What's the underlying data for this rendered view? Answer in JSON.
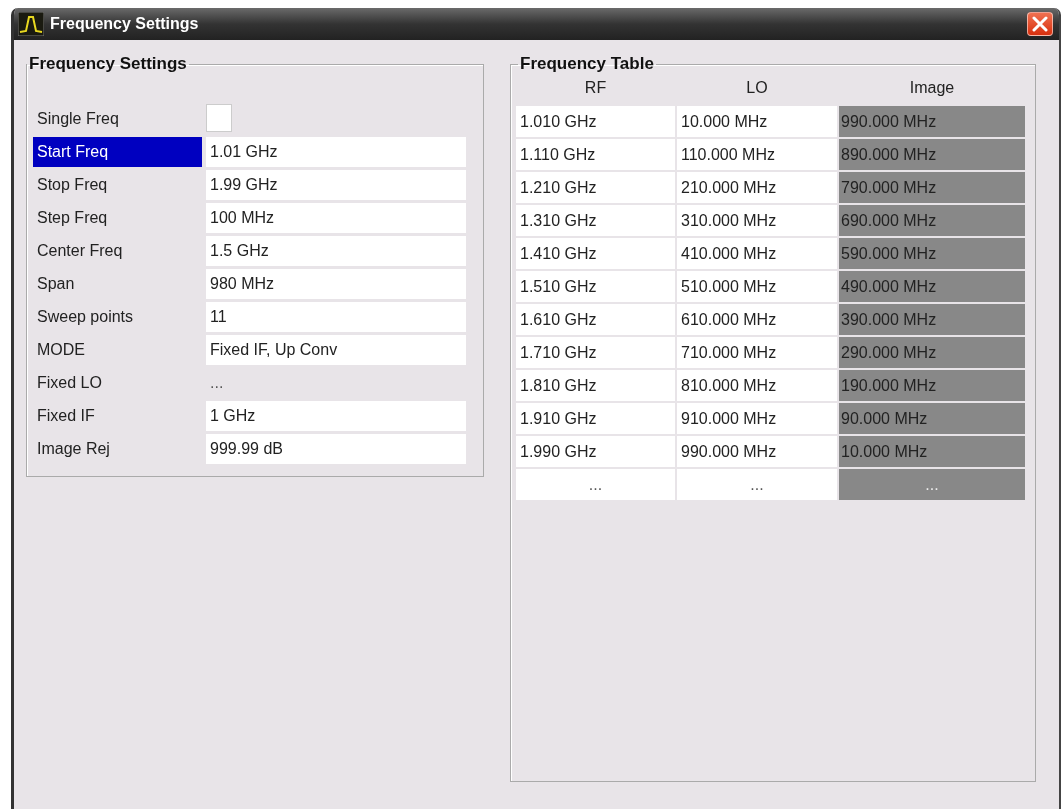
{
  "window": {
    "title": "Frequency Settings"
  },
  "settings": {
    "title": "Frequency Settings",
    "rows": [
      {
        "label": "Single Freq",
        "kind": "checkbox",
        "checked": false,
        "selected": false
      },
      {
        "label": "Start Freq",
        "kind": "field",
        "value": "1.01 GHz",
        "selected": true
      },
      {
        "label": "Stop Freq",
        "kind": "field",
        "value": "1.99 GHz",
        "selected": false
      },
      {
        "label": "Step Freq",
        "kind": "field",
        "value": "100 MHz",
        "selected": false
      },
      {
        "label": "Center Freq",
        "kind": "field",
        "value": "1.5 GHz",
        "selected": false
      },
      {
        "label": "Span",
        "kind": "field",
        "value": "980 MHz",
        "selected": false
      },
      {
        "label": "Sweep points",
        "kind": "field",
        "value": "11",
        "selected": false
      },
      {
        "label": "MODE",
        "kind": "field",
        "value": "Fixed IF, Up Conv",
        "selected": false
      },
      {
        "label": "Fixed LO",
        "kind": "readonly",
        "value": "...",
        "selected": false
      },
      {
        "label": "Fixed IF",
        "kind": "field",
        "value": "1 GHz",
        "selected": false
      },
      {
        "label": "Image Rej",
        "kind": "field",
        "value": "999.99 dB",
        "selected": false
      }
    ]
  },
  "table": {
    "title": "Frequency Table",
    "columns": [
      {
        "label": "RF",
        "shaded": false
      },
      {
        "label": "LO",
        "shaded": false
      },
      {
        "label": "Image",
        "shaded": true
      }
    ],
    "rows": [
      [
        "1.010 GHz",
        "10.000 MHz",
        "990.000 MHz"
      ],
      [
        "1.110 GHz",
        "110.000 MHz",
        "890.000 MHz"
      ],
      [
        "1.210 GHz",
        "210.000 MHz",
        "790.000 MHz"
      ],
      [
        "1.310 GHz",
        "310.000 MHz",
        "690.000 MHz"
      ],
      [
        "1.410 GHz",
        "410.000 MHz",
        "590.000 MHz"
      ],
      [
        "1.510 GHz",
        "510.000 MHz",
        "490.000 MHz"
      ],
      [
        "1.610 GHz",
        "610.000 MHz",
        "390.000 MHz"
      ],
      [
        "1.710 GHz",
        "710.000 MHz",
        "290.000 MHz"
      ],
      [
        "1.810 GHz",
        "810.000 MHz",
        "190.000 MHz"
      ],
      [
        "1.910 GHz",
        "910.000 MHz",
        "90.000 MHz"
      ],
      [
        "1.990 GHz",
        "990.000 MHz",
        "10.000 MHz"
      ],
      [
        "...",
        "...",
        "..."
      ]
    ]
  }
}
